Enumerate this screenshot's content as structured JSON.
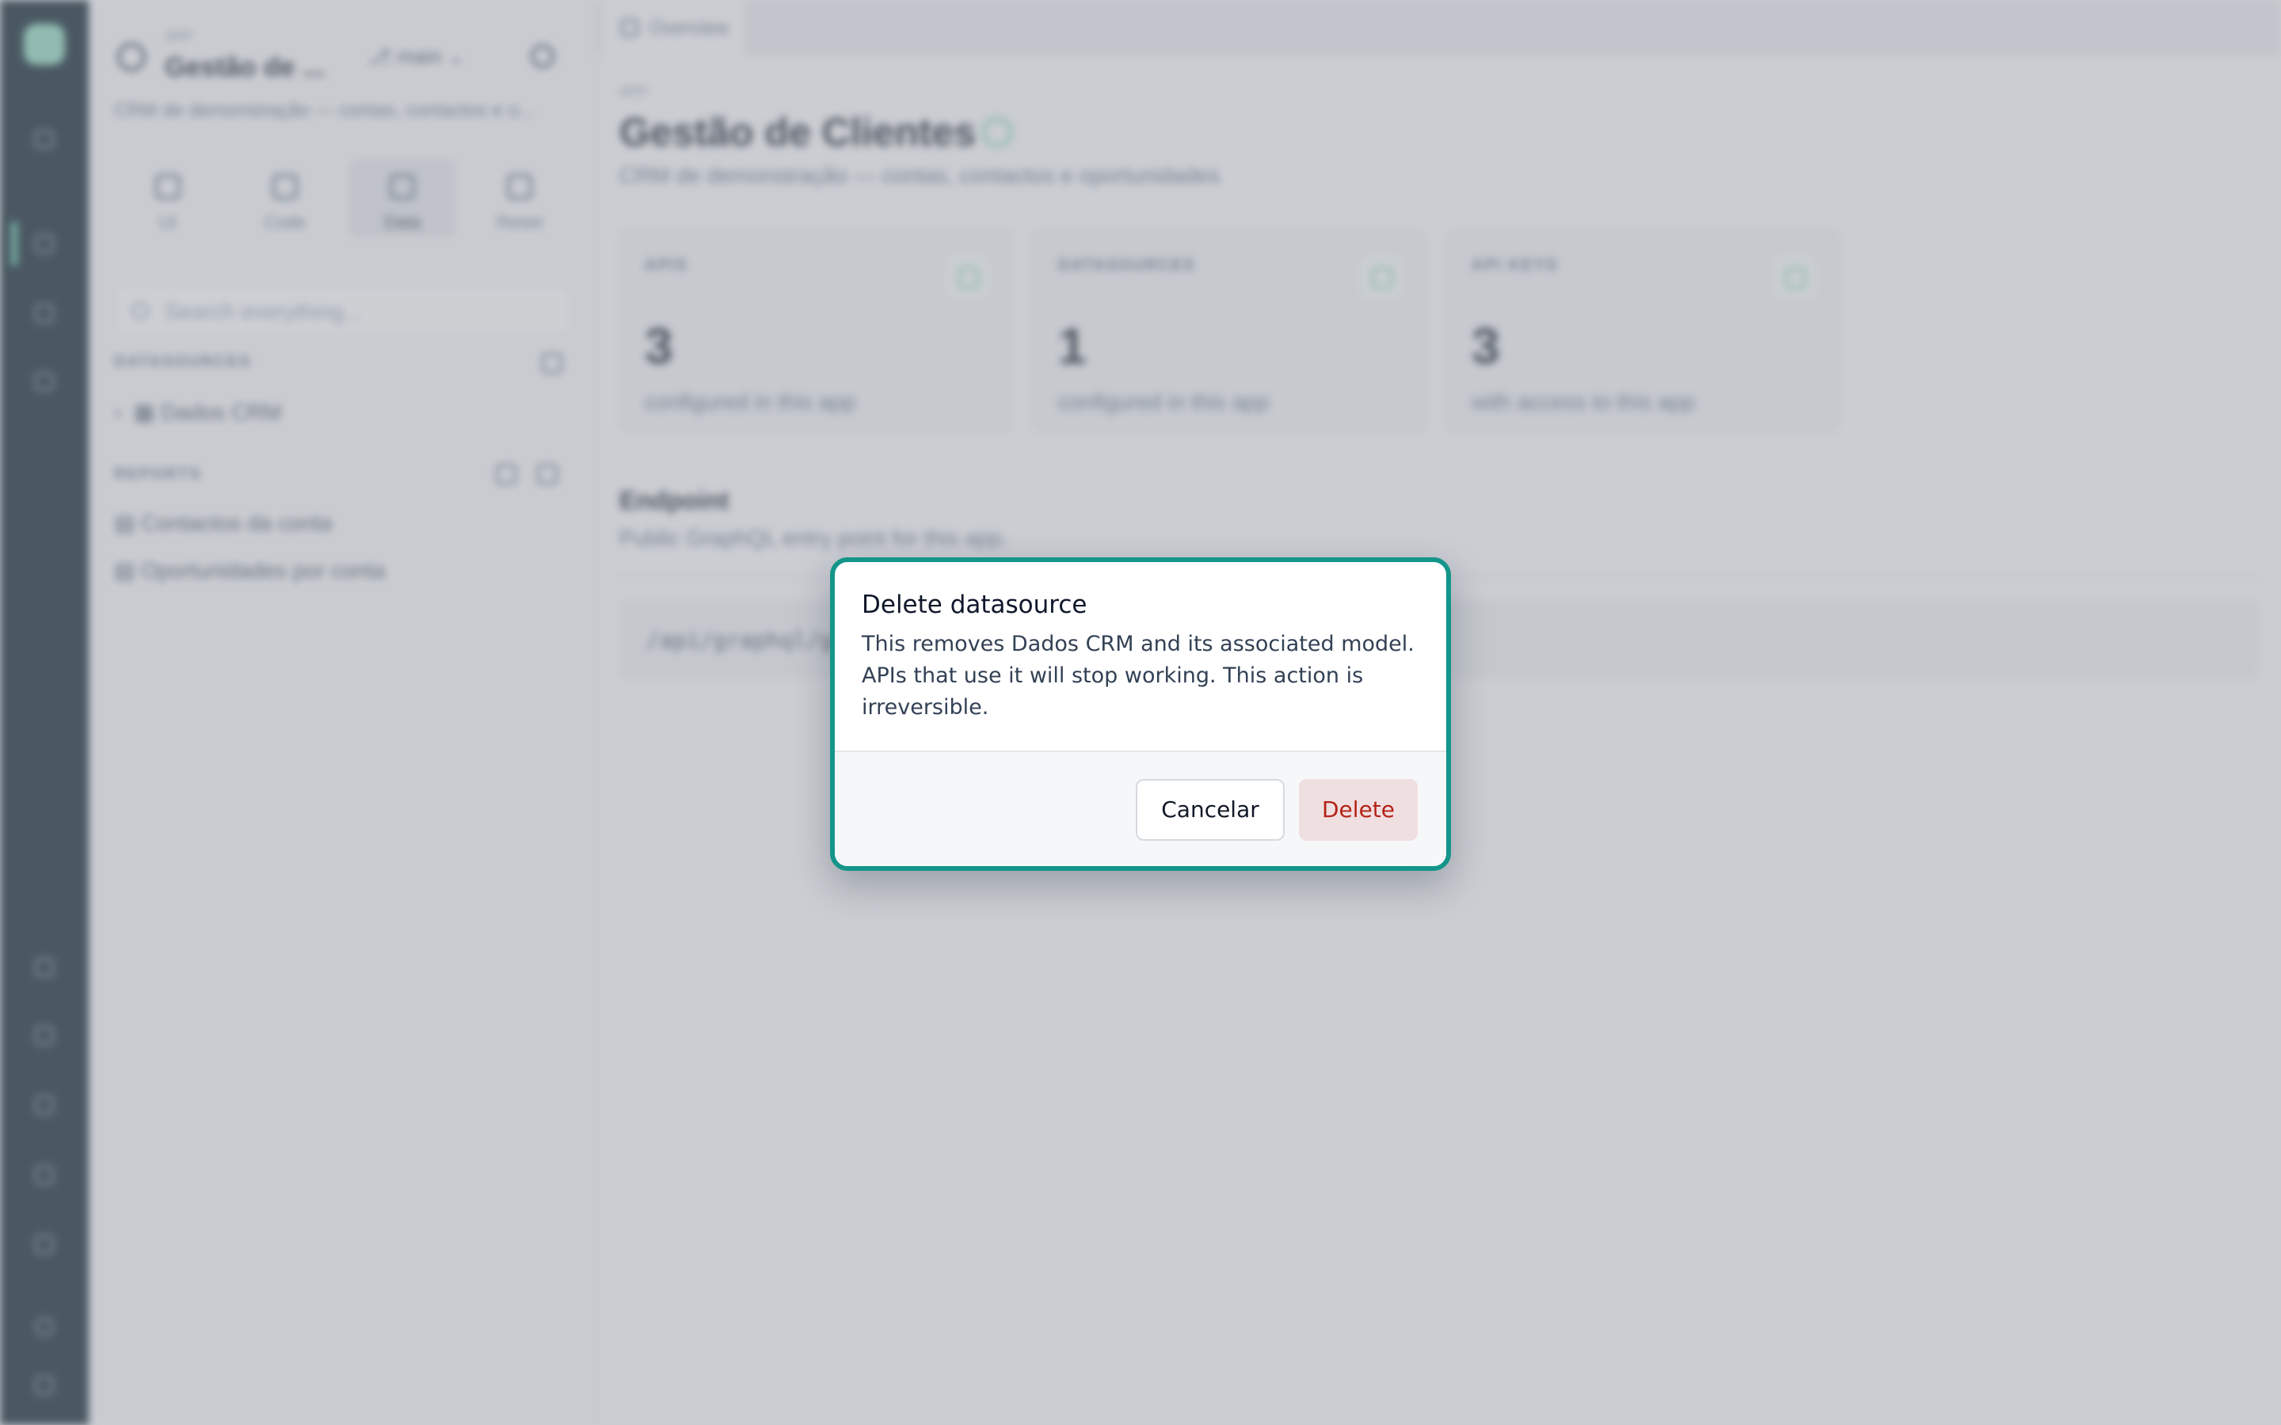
{
  "sidebar": {
    "kicker": "APP",
    "app_title": "Gestão de ...",
    "branch": "main",
    "description": "CRM de demonstração — contas, contactos e o...",
    "tabs": [
      {
        "label": "UI"
      },
      {
        "label": "Code"
      },
      {
        "label": "Data"
      },
      {
        "label": "Reset"
      }
    ],
    "search_placeholder": "Search everything...",
    "datasources_heading": "DATASOURCES",
    "datasources": [
      "Dados CRM"
    ],
    "reports_heading": "REPORTS",
    "reports": [
      "Contactos da conta",
      "Oportunidades por conta"
    ]
  },
  "main": {
    "tab_label": "Overview",
    "kicker": "APP",
    "title": "Gestão de Clientes",
    "description": "CRM de demonstração — contas, contactos e oportunidades",
    "stats": [
      {
        "label": "APIS",
        "value": "3",
        "sub": "configured in this app"
      },
      {
        "label": "DATASOURCES",
        "value": "1",
        "sub": "configured in this app"
      },
      {
        "label": "API KEYS",
        "value": "3",
        "sub": "with access to this app"
      }
    ],
    "endpoint_title": "Endpoint",
    "endpoint_desc": "Public GraphQL entry point for this app.",
    "endpoint_value": "/api/graphql/gest"
  },
  "dialog": {
    "title": "Delete datasource",
    "message": "This removes Dados CRM and its associated model. APIs that use it will stop working. This action is irreversible.",
    "cancel_label": "Cancelar",
    "delete_label": "Delete"
  },
  "colors": {
    "rail": "#0f2430",
    "dialog_border": "#14958a",
    "danger_text": "#b42318",
    "danger_bg": "#f0dfe0"
  }
}
